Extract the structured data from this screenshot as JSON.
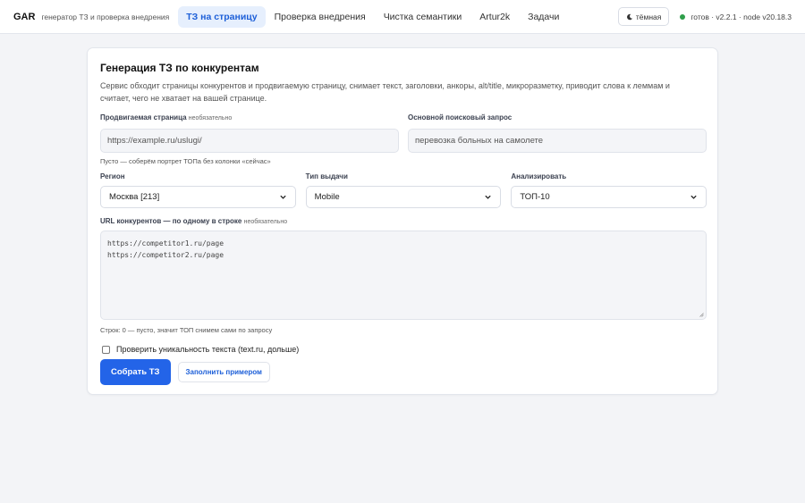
{
  "header": {
    "brand": "GAR",
    "subtitle": "генератор ТЗ и проверка внедрения",
    "nav": [
      {
        "label": "ТЗ на страницу",
        "active": true
      },
      {
        "label": "Проверка внедрения",
        "active": false
      },
      {
        "label": "Чистка семантики",
        "active": false
      },
      {
        "label": "Artur2k",
        "active": false
      },
      {
        "label": "Задачи",
        "active": false
      }
    ],
    "theme_label": "тёмная",
    "status": "готов · v2.2.1 · node v20.18.3",
    "status_color": "#2e9e4a"
  },
  "form": {
    "title": "Генерация ТЗ по конкурентам",
    "description": "Сервис обходит страницы конкурентов и продвигаемую страницу, снимает текст, заголовки, анкоры, alt/title, микроразметку, приводит слова к леммам и считает, чего не хватает на вашей странице.",
    "page_label": "Продвигаемая страница",
    "page_optional": "необязательно",
    "page_placeholder": "https://example.ru/uslugi/",
    "page_hint": "Пусто — соберём портрет ТОПа без колонки «сейчас»",
    "query_label": "Основной поисковый запрос",
    "query_value": "перевозка больных на самолете",
    "region_label": "Регион",
    "region_value": "Москва [213]",
    "serp_label": "Тип выдачи",
    "serp_value": "Mobile",
    "analyze_label": "Анализировать",
    "analyze_value": "ТОП-10",
    "urls_label": "URL конкурентов — по одному в строке",
    "urls_optional": "необязательно",
    "urls_lines": [
      "https://competitor1.ru/page",
      "https://competitor2.ru/page"
    ],
    "urls_hint": "Строк: 0 — пусто, значит ТОП снимем сами по запросу",
    "uniqueness_label": "Проверить уникальность текста (text.ru, дольше)",
    "submit_label": "Собрать ТЗ",
    "example_label": "Заполнить примером"
  },
  "colors": {
    "accent": "#2364e8",
    "nav_active_bg": "#e6effd"
  }
}
